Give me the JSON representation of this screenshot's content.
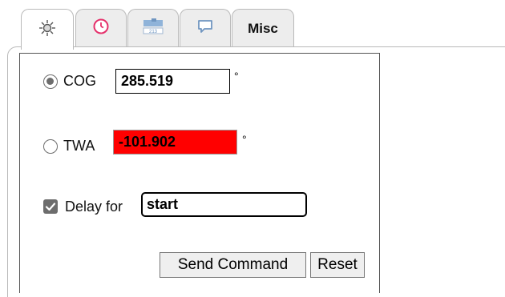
{
  "tabs": [
    {
      "id": "tab-1",
      "icon": "sun-icon",
      "active": true
    },
    {
      "id": "tab-2",
      "icon": "clock-icon",
      "active": false
    },
    {
      "id": "tab-3",
      "icon": "display-icon",
      "active": false
    },
    {
      "id": "tab-4",
      "icon": "speech-bubble-icon",
      "active": false
    },
    {
      "id": "tab-5",
      "label": "Misc",
      "active": false
    }
  ],
  "form": {
    "cog": {
      "label": "COG",
      "value": "285.519",
      "unit": "°",
      "selected": true
    },
    "twa": {
      "label": "TWA",
      "value": "-101.902",
      "unit": "°",
      "selected": false
    },
    "delay": {
      "label": "Delay for",
      "value": "start",
      "checked": true
    }
  },
  "buttons": {
    "send": "Send Command",
    "reset": "Reset"
  },
  "colors": {
    "error_field": "#ff0000",
    "tab_bg": "#ededed",
    "active_tab_bg": "#ffffff"
  }
}
